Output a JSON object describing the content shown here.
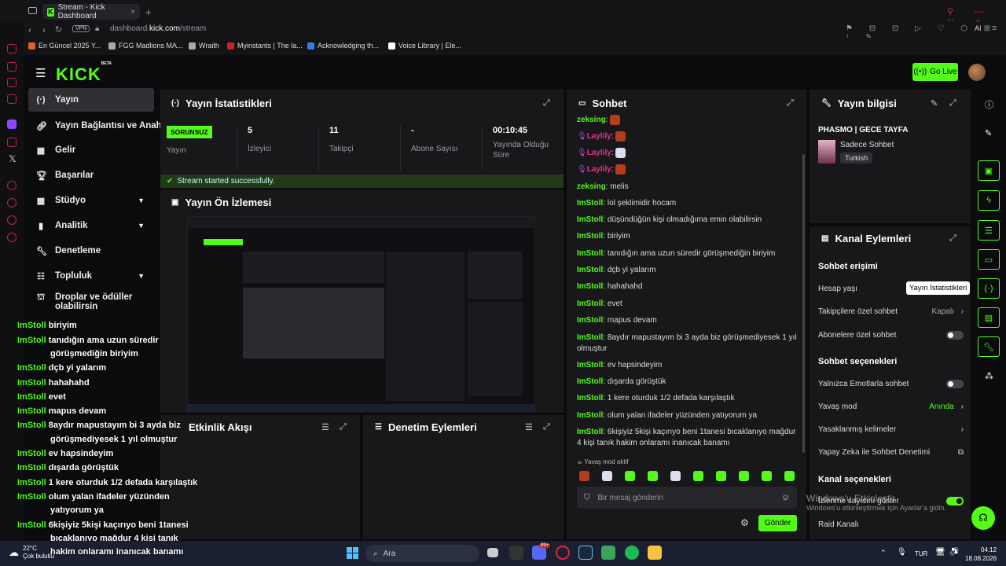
{
  "browser": {
    "tab_title": "Stream - Kick Dashboard",
    "new_tab": "+",
    "vpn": "VPN",
    "url_host": "dashboard.",
    "url_domain": "kick.com",
    "url_path": "/stream",
    "ai_label": "AI",
    "bookmarks": [
      {
        "label": "En Güncel 2025 Y...",
        "color": "#e06030"
      },
      {
        "label": "FGG Madlions MA...",
        "color": "#ccc"
      },
      {
        "label": "Wraith",
        "color": "#ccc"
      },
      {
        "label": "Myinstants | The la...",
        "color": "#d02020"
      },
      {
        "label": "Acknowledging th...",
        "color": "#3080e0"
      },
      {
        "label": "Voice Library | Ele...",
        "color": "#fff"
      }
    ]
  },
  "header": {
    "logo": "KICK",
    "logo_badge": "BETA",
    "go_live": "Go Live"
  },
  "nav": [
    {
      "label": "Yayın",
      "icon": "broadcast-icon"
    },
    {
      "label": "Yayın Bağlantısı ve Anahtarı",
      "icon": "link-icon"
    },
    {
      "label": "Gelir",
      "icon": "money-icon"
    },
    {
      "label": "Başarılar",
      "icon": "trophy-icon"
    },
    {
      "label": "Stüdyo",
      "icon": "studio-icon"
    },
    {
      "label": "Analitik",
      "icon": "chart-icon"
    },
    {
      "label": "Denetleme",
      "icon": "wrench-icon"
    },
    {
      "label": "Topluluk",
      "icon": "community-icon"
    },
    {
      "label": "Droplar ve ödüller olabilirsin",
      "icon": "gift-icon"
    }
  ],
  "stats": {
    "title": "Yayın İstatistikleri",
    "status": "SORUNSUZ",
    "status_label": "Yayın",
    "viewers": "5",
    "viewers_label": "İzleyici",
    "followers": "11",
    "followers_label": "Takipçi",
    "subs": "-",
    "subs_label": "Abone Sayısı",
    "uptime": "00:10:45",
    "uptime_label": "Yayında Olduğu Süre",
    "success": "Stream started successfully."
  },
  "preview": {
    "title": "Yayın Ön İzlemesi"
  },
  "activity": {
    "title": "Etkinlik Akışı"
  },
  "moderation": {
    "title": "Denetim Eylemleri"
  },
  "chat": {
    "title": "Sohbet",
    "messages": [
      {
        "user": "zeksing",
        "text": "",
        "emote": "r"
      },
      {
        "user": "Laylily",
        "text": "",
        "emote": "r",
        "badge": true
      },
      {
        "user": "Laylily",
        "text": "",
        "emote": "w",
        "badge": true
      },
      {
        "user": "Laylily",
        "text": "",
        "emote": "r",
        "badge": true
      },
      {
        "user": "zeksing",
        "text": "melis"
      },
      {
        "user": "ImStoll",
        "text": "lol şeklimidir hocam"
      },
      {
        "user": "ImStoll",
        "text": "düşündüğün kişi olmadığıma emin olabilirsin"
      },
      {
        "user": "ImStoll",
        "text": "biriyim"
      },
      {
        "user": "ImStoll",
        "text": "tanıdığın ama uzun süredir görüşmediğin biriyim"
      },
      {
        "user": "ImStoll",
        "text": "dçb yi yalarım"
      },
      {
        "user": "ImStoll",
        "text": "hahahahd"
      },
      {
        "user": "ImStoll",
        "text": "evet"
      },
      {
        "user": "ImStoll",
        "text": "mapus devam"
      },
      {
        "user": "ImStoll",
        "text": "8aydır mapustayım bi 3 ayda biz görüşmediyesek 1 yıl olmuştur"
      },
      {
        "user": "ImStoll",
        "text": "ev hapsindeyim"
      },
      {
        "user": "ImStoll",
        "text": "dışarda görüştük"
      },
      {
        "user": "ImStoll",
        "text": "1 kere oturduk 1/2 defada karşılaştık"
      },
      {
        "user": "ImStoll",
        "text": "olum yalan ifadeler yüzünden yatıyorum ya"
      },
      {
        "user": "ImStoll",
        "text": "6kişiyiz 5kişi kaçırıyo beni 1tanesi bıcaklanıyo mağdur 4 kişi tanık hakim onlaramı inanıcak banamı"
      }
    ],
    "slow_mode": "Yavaş mod aktif",
    "placeholder": "Bir mesaj gönderin",
    "send": "Gönder"
  },
  "stream_info": {
    "title": "Yayın bilgisi",
    "stream_name": "PHASMO | GECE TAYFA",
    "category": "Sadece Sohbet",
    "language": "Turkish"
  },
  "channel_actions": {
    "title": "Kanal Eylemleri",
    "chat_access": "Sohbet erişimi",
    "account_age": "Hesap yaşı",
    "tooltip": "Yayın İstatistikleri",
    "followers_only": "Takipçilere özel sohbet",
    "followers_only_value": "Kapalı",
    "subs_only": "Abonelere özel sohbet",
    "chat_options": "Sohbet seçenekleri",
    "emotes_only": "Yalnızca Emotlarla sohbet",
    "slow_mode": "Yavaş mod",
    "slow_mode_value": "Anında",
    "banned_words": "Yasaklanmış kelimeler",
    "ai_moderation": "Yapay Zeka ile Sohbet Denetimi",
    "channel_options": "Kanal seçenekleri",
    "show_viewers": "İzlenme sayısını göster",
    "raid": "Raid Kanalı"
  },
  "overlay": [
    {
      "user": "ImStoll",
      "text": "biriyim"
    },
    {
      "user": "ImStoll",
      "text": "tanıdığın ama uzun süredir"
    },
    {
      "user": "",
      "text": "görüşmediğin biriyim"
    },
    {
      "user": "ImStoll",
      "text": "dçb yi yalarım"
    },
    {
      "user": "ImStoll",
      "text": "hahahahd"
    },
    {
      "user": "ImStoll",
      "text": "evet"
    },
    {
      "user": "ImStoll",
      "text": "mapus devam"
    },
    {
      "user": "ImStoll",
      "text": "8aydır mapustayım bi 3 ayda biz"
    },
    {
      "user": "",
      "text": "görüşmediyesek 1 yıl olmuştur"
    },
    {
      "user": "ImStoll",
      "text": "ev hapsindeyim"
    },
    {
      "user": "ImStoll",
      "text": "dışarda görüştük"
    },
    {
      "user": "ImStoll",
      "text": "1 kere oturduk 1/2 defada karşılaştık"
    },
    {
      "user": "ImStoll",
      "text": "olum yalan ifadeler yüzünden"
    },
    {
      "user": "",
      "text": "yatıyorum ya"
    },
    {
      "user": "ImStoll",
      "text": "6kişiyiz 5kişi kaçırıyo beni 1tanesi"
    },
    {
      "user": "",
      "text": "bıcaklanıyo mağdur 4 kişi tanık"
    },
    {
      "user": "",
      "text": "hakim onlaramı inanıcak banamı"
    }
  ],
  "watermark": {
    "line1": "Windows'u Etkinleştir",
    "line2": "Windows'u etkinleştirmek için Ayarlar'a gidin."
  },
  "taskbar": {
    "weather_temp": "22°C",
    "weather_desc": "Çok bulutlu",
    "search": "Ara",
    "lang": "TUR",
    "time": "04:12",
    "date": "18.08.2026",
    "notif_badge": "99+"
  }
}
